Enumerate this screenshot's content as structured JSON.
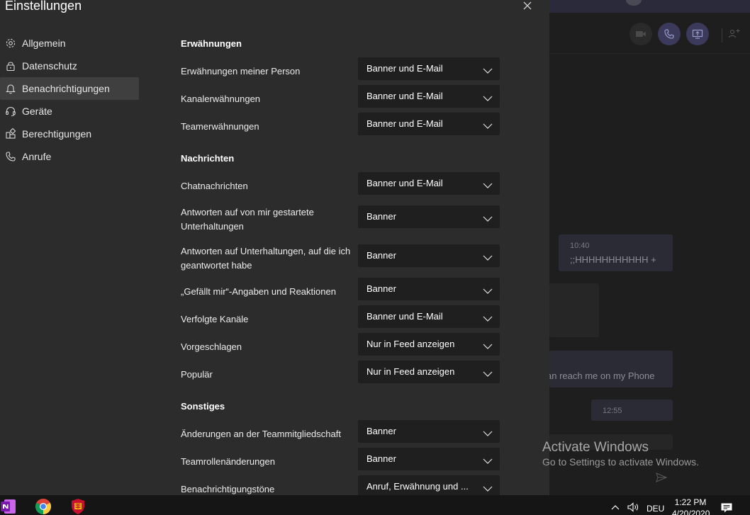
{
  "dialog": {
    "title": "Einstellungen",
    "nav": [
      {
        "label": "Allgemein",
        "icon": "gear-icon"
      },
      {
        "label": "Datenschutz",
        "icon": "lock-icon"
      },
      {
        "label": "Benachrichtigungen",
        "icon": "bell-icon",
        "active": true
      },
      {
        "label": "Geräte",
        "icon": "headset-icon"
      },
      {
        "label": "Berechtigungen",
        "icon": "permissions-icon"
      },
      {
        "label": "Anrufe",
        "icon": "phone-icon"
      }
    ],
    "sections": {
      "mentions": {
        "title": "Erwähnungen",
        "rows": [
          {
            "label": "Erwähnungen meiner Person",
            "value": "Banner und E-Mail"
          },
          {
            "label": "Kanalerwähnungen",
            "value": "Banner und E-Mail"
          },
          {
            "label": "Teamerwähnungen",
            "value": "Banner und E-Mail"
          }
        ]
      },
      "messages": {
        "title": "Nachrichten",
        "rows": [
          {
            "label": "Chatnachrichten",
            "value": "Banner und E-Mail"
          },
          {
            "label": "Antworten auf von mir gestartete Unterhaltungen",
            "value": "Banner"
          },
          {
            "label": "Antworten auf Unterhaltungen, auf die ich geantwortet habe",
            "value": "Banner"
          },
          {
            "label": "„Gefällt mir“-Angaben und Reaktionen",
            "value": "Banner"
          },
          {
            "label": "Verfolgte Kanäle",
            "value": "Banner und E-Mail"
          },
          {
            "label": "Vorgeschlagen",
            "value": "Nur in Feed anzeigen"
          },
          {
            "label": "Populär",
            "value": "Nur in Feed anzeigen"
          }
        ]
      },
      "other": {
        "title": "Sonstiges",
        "rows": [
          {
            "label": "Änderungen an der Teammitgliedschaft",
            "value": "Banner"
          },
          {
            "label": "Teamrollenänderungen",
            "value": "Banner"
          },
          {
            "label": "Benachrichtigungstöne",
            "value": "Anruf, Erwähnung und ..."
          }
        ]
      }
    }
  },
  "background_chat": {
    "bubble1_time": "10:40",
    "bubble1_text": ";;HHHHHHHHHHH +",
    "bubble3_text": "an reach me on my Phone",
    "bubble4_time": "12:55"
  },
  "watermark": {
    "title": "Activate Windows",
    "subtitle": "Go to Settings to activate Windows."
  },
  "taskbar": {
    "apps": [
      "onenote-icon",
      "chrome-icon",
      "shield-app-icon"
    ],
    "language": "DEU",
    "time": "1:22 PM",
    "date": "4/20/2020"
  },
  "colors": {
    "dialog_bg": "#2d2c2c",
    "select_bg": "#1f1f1f",
    "nav_active_bg": "#403f3f",
    "taskbar_bg": "#151515",
    "accent": "#6264a7"
  }
}
